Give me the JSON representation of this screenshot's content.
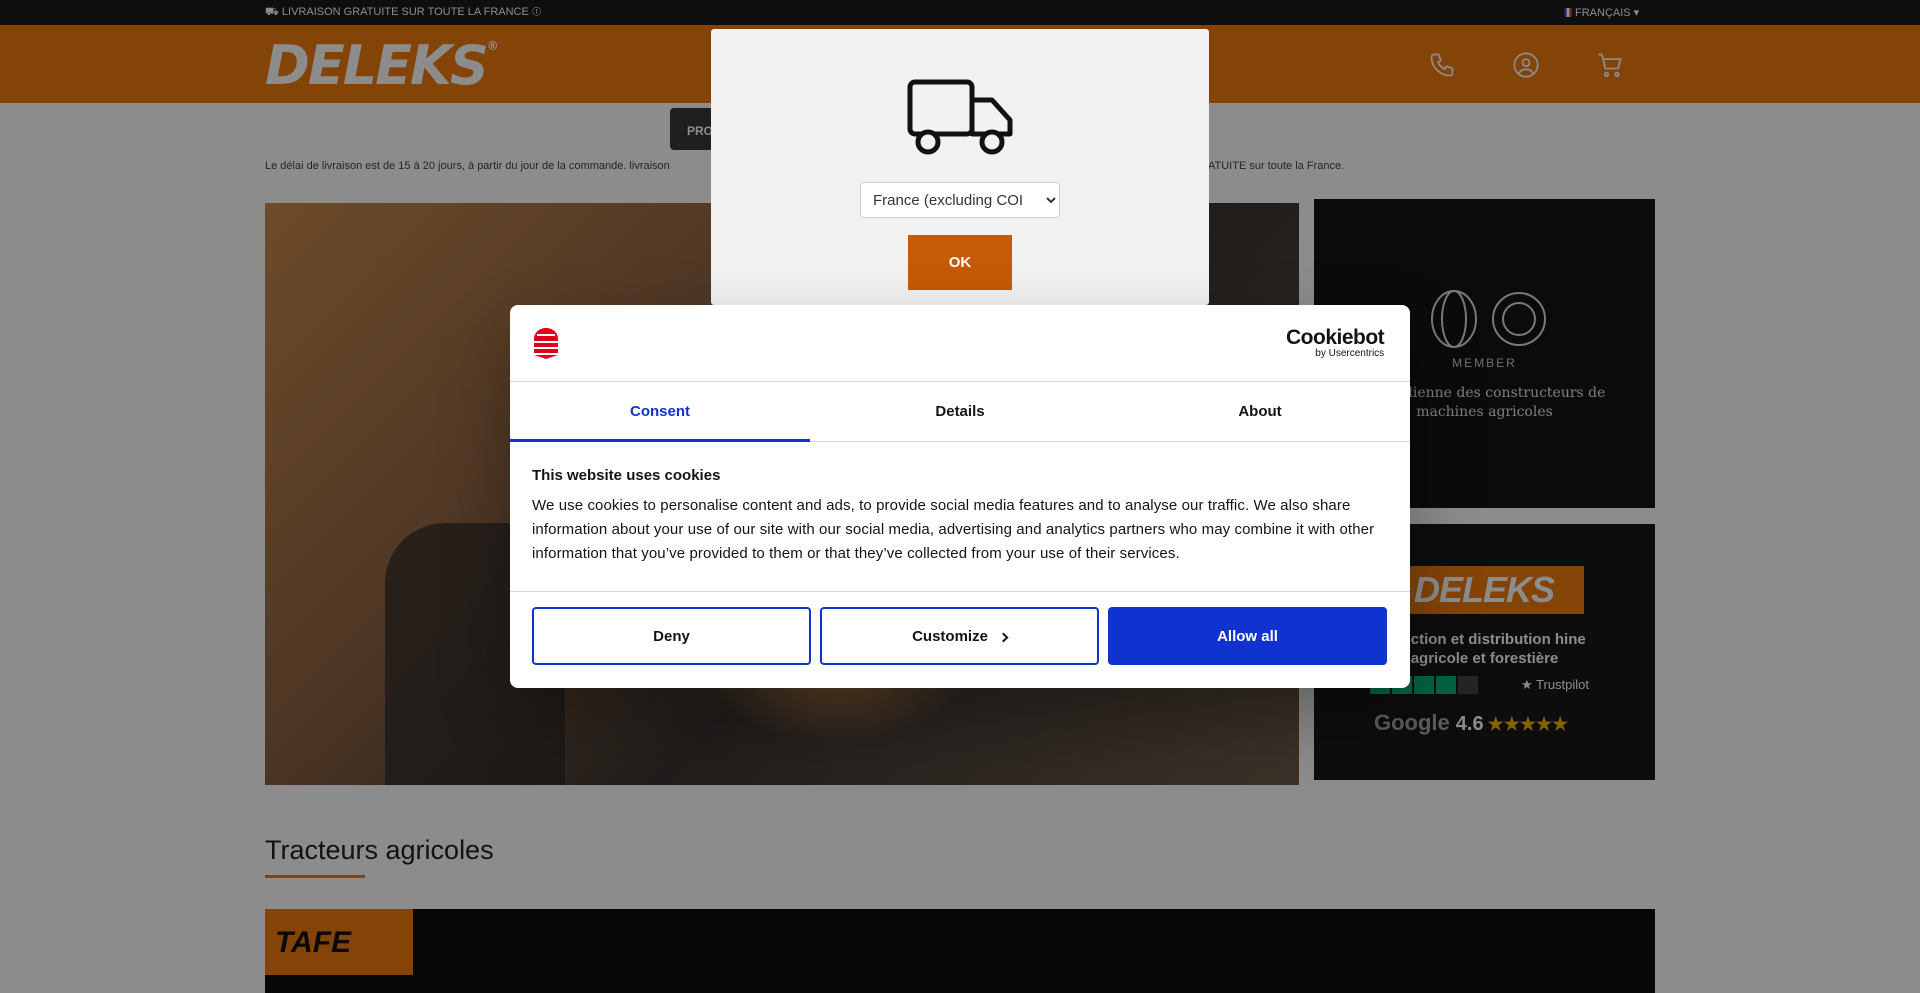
{
  "topbar": {
    "promo": "LIVRAISON GRATUITE SUR TOUTE LA FRANCE",
    "language": "FRANÇAIS"
  },
  "header": {
    "logo": "DELEKS"
  },
  "nav": {
    "products_label": "PRO"
  },
  "delivery_text": {
    "start": "Le délai de livraison est de 15 à 20 jours, à partir du jour de la commande. livraison",
    "end": "ATUITE sur toute la France."
  },
  "sidebar": {
    "member_label": "MEMBER",
    "association": "ion italienne des constructeurs de machines agricoles",
    "brand": "DELEKS",
    "tagline": "oduction et distribution hine agricole et forestière",
    "trustpilot": "Trustpilot",
    "google": "Google",
    "google_rating": "4.6",
    "google_stars": "★★★★★"
  },
  "section": {
    "title": "Tracteurs agricoles",
    "banner_brand": "TAFE"
  },
  "country_modal": {
    "selected_country": "France (excluding COI",
    "ok_label": "OK"
  },
  "cookie_dialog": {
    "brand_name": "Cookiebot",
    "brand_sub": "by Usercentrics",
    "tabs": [
      {
        "label": "Consent",
        "active": true
      },
      {
        "label": "Details",
        "active": false
      },
      {
        "label": "About",
        "active": false
      }
    ],
    "heading": "This website uses cookies",
    "body": "We use cookies to personalise content and ads, to provide social media features and to analyse our traffic. We also share information about your use of our site with our social media, advertising and analytics partners who may combine it with other information that you’ve provided to them or that they’ve collected from your use of their services.",
    "deny_label": "Deny",
    "customize_label": "Customize",
    "allow_label": "Allow all",
    "accent_color": "#1032cf"
  },
  "colors": {
    "brand_orange": "#f07d10",
    "ok_button": "#c65a06"
  }
}
